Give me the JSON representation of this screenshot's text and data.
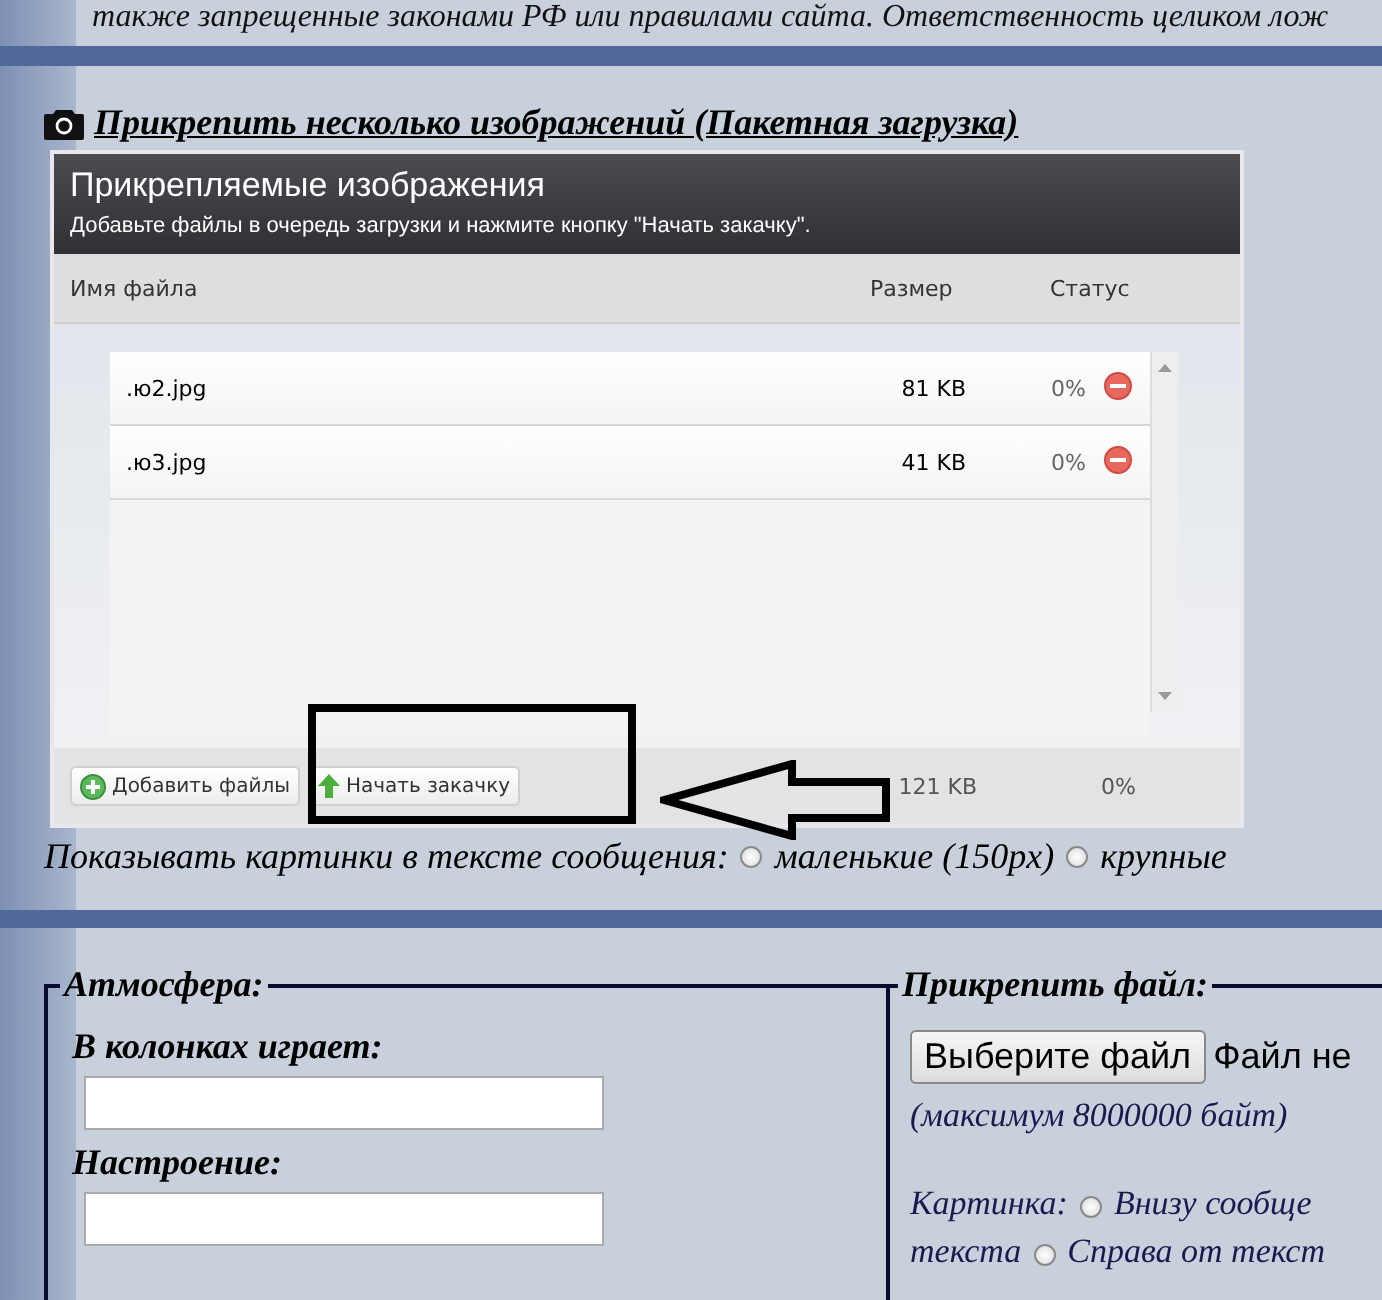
{
  "notice_text": "также запрещенные законами РФ или правилами сайта. Ответственность целиком лож",
  "batch_upload": {
    "title": "Прикрепить несколько изображений (Пакетная загрузка)",
    "panel_title": "Прикрепляемые изображения",
    "panel_subtitle": "Добавьте файлы в очередь загрузки и нажмите кнопку \"Начать закачку\".",
    "columns": [
      "Имя файла",
      "Размер",
      "Статус"
    ],
    "files": [
      {
        "name": ".ю2.jpg",
        "size": "81 KB",
        "status": "0%"
      },
      {
        "name": ".ю3.jpg",
        "size": "41 KB",
        "status": "0%"
      }
    ],
    "buttons": [
      {
        "label": "Добавить файлы",
        "kind": "add"
      },
      {
        "label": "Начать закачку",
        "kind": "start"
      }
    ],
    "total_size": "121 KB",
    "total_status": "0%"
  },
  "image_display": {
    "label": "Показывать картинки в тексте сообщения:",
    "options": [
      {
        "label": "маленькие (150px)",
        "selected": false
      },
      {
        "label": "крупные",
        "selected": false
      }
    ]
  },
  "atmosphere": {
    "legend": "Атмосфера:",
    "fields": [
      {
        "label": "В колонках играет:"
      },
      {
        "label": "Настроение:"
      }
    ]
  },
  "attach_file": {
    "legend": "Прикрепить файл:",
    "button": "Выберите файл",
    "file_status": "Файл не",
    "hint": "(максимум 8000000 байт)",
    "picture_label": "Картинка:",
    "options": [
      {
        "label": "Внизу сообще",
        "selected": false
      },
      {
        "label": "Справа от текст",
        "selected": false
      }
    ],
    "line_2_lead": "текста"
  }
}
